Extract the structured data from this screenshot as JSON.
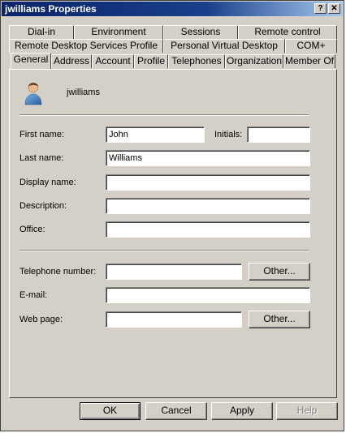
{
  "window": {
    "title": "jwilliams Properties",
    "help_label": "?",
    "close_label": "✕"
  },
  "tabs": {
    "row1": [
      "Dial-in",
      "Environment",
      "Sessions",
      "Remote control"
    ],
    "row2": [
      "Remote Desktop Services Profile",
      "Personal Virtual Desktop",
      "COM+"
    ],
    "row3": [
      "General",
      "Address",
      "Account",
      "Profile",
      "Telephones",
      "Organization",
      "Member Of"
    ],
    "active": "General"
  },
  "general": {
    "username": "jwilliams",
    "first_name_label": "First name:",
    "first_name_value": "John",
    "initials_label": "Initials:",
    "initials_value": "",
    "last_name_label": "Last name:",
    "last_name_value": "Williams",
    "display_name_label": "Display name:",
    "display_name_value": "",
    "description_label": "Description:",
    "description_value": "",
    "office_label": "Office:",
    "office_value": "",
    "telephone_label": "Telephone number:",
    "telephone_value": "",
    "telephone_other_label": "Other...",
    "email_label": "E-mail:",
    "email_value": "",
    "webpage_label": "Web page:",
    "webpage_value": "",
    "webpage_other_label": "Other..."
  },
  "buttons": {
    "ok": "OK",
    "cancel": "Cancel",
    "apply": "Apply",
    "help": "Help"
  },
  "icons": {
    "user": "user-icon"
  }
}
